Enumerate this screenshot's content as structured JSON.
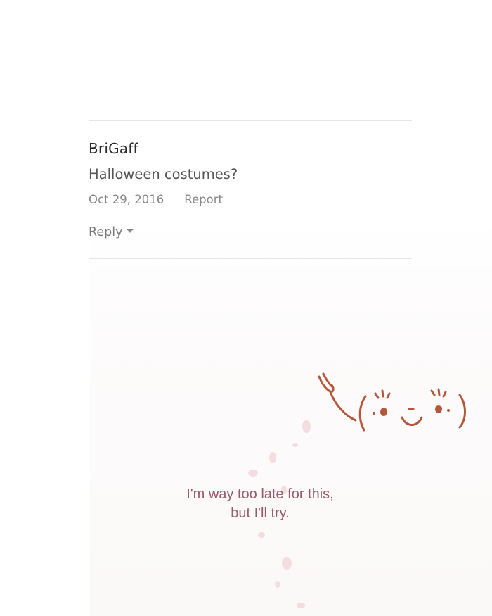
{
  "comment": {
    "username": "BriGaff",
    "text": "Halloween costumes?",
    "date": "Oct 29, 2016",
    "report_label": "Report",
    "reply_label": "Reply"
  },
  "comic": {
    "caption_line1": "I'm way too late for this,",
    "caption_line2": "but I'll try.",
    "caption_color": "#9a5a6c",
    "drawing_color": "#b5573a",
    "face_icon": "smiling-face-with-raised-hand-icon"
  },
  "colors": {
    "divider": "#e6e6e6",
    "username": "#2a2a2a",
    "body_text": "#555555",
    "meta_text": "#888888"
  }
}
